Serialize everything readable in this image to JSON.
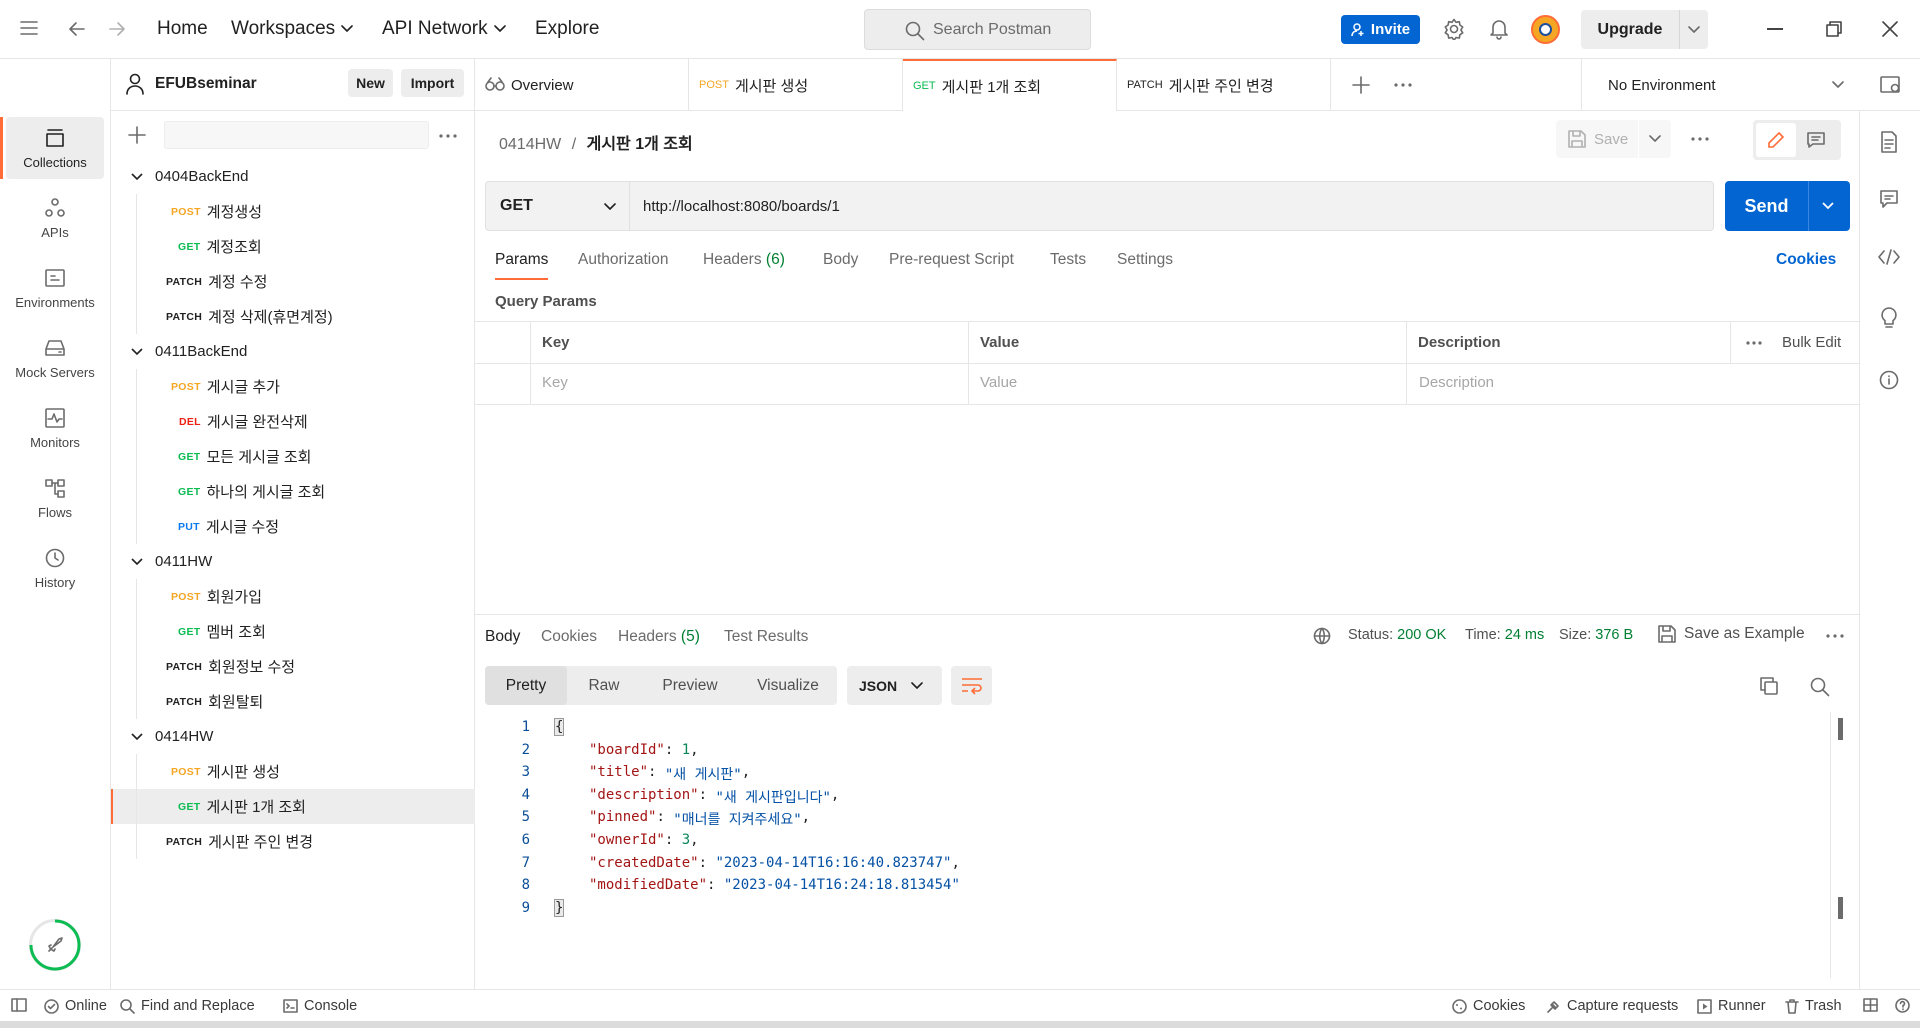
{
  "topbar": {
    "home": "Home",
    "workspaces": "Workspaces",
    "api_network": "API Network",
    "explore": "Explore",
    "search_placeholder": "Search Postman",
    "invite": "Invite",
    "upgrade": "Upgrade"
  },
  "rail": {
    "items": [
      {
        "label": "Collections",
        "icon": "collections-icon"
      },
      {
        "label": "APIs",
        "icon": "apis-icon"
      },
      {
        "label": "Environments",
        "icon": "environments-icon"
      },
      {
        "label": "Mock Servers",
        "icon": "mock-servers-icon"
      },
      {
        "label": "Monitors",
        "icon": "monitors-icon"
      },
      {
        "label": "Flows",
        "icon": "flows-icon"
      },
      {
        "label": "History",
        "icon": "history-icon"
      }
    ]
  },
  "workspace": {
    "name": "EFUBseminar",
    "new_label": "New",
    "import_label": "Import"
  },
  "tree": [
    {
      "type": "folder",
      "label": "0404BackEnd"
    },
    {
      "type": "request",
      "method": "POST",
      "label": "계정생성"
    },
    {
      "type": "request",
      "method": "GET",
      "label": "계정조회"
    },
    {
      "type": "request",
      "method": "PATCH",
      "label": "계정 수정"
    },
    {
      "type": "request",
      "method": "PATCH",
      "label": "계정 삭제(휴면계정)"
    },
    {
      "type": "folder",
      "label": "0411BackEnd"
    },
    {
      "type": "request",
      "method": "POST",
      "label": "게시글 추가"
    },
    {
      "type": "request",
      "method": "DEL",
      "label": "게시글 완전삭제"
    },
    {
      "type": "request",
      "method": "GET",
      "label": "모든 게시글 조회"
    },
    {
      "type": "request",
      "method": "GET",
      "label": "하나의 게시글 조회"
    },
    {
      "type": "request",
      "method": "PUT",
      "label": "게시글 수정"
    },
    {
      "type": "folder",
      "label": "0411HW"
    },
    {
      "type": "request",
      "method": "POST",
      "label": "회원가입"
    },
    {
      "type": "request",
      "method": "GET",
      "label": "멤버 조회"
    },
    {
      "type": "request",
      "method": "PATCH",
      "label": "회원정보 수정"
    },
    {
      "type": "request",
      "method": "PATCH",
      "label": "회원탈퇴"
    },
    {
      "type": "folder",
      "label": "0414HW"
    },
    {
      "type": "request",
      "method": "POST",
      "label": "게시판 생성"
    },
    {
      "type": "request",
      "method": "GET",
      "label": "게시판 1개 조회",
      "selected": true
    },
    {
      "type": "request",
      "method": "PATCH",
      "label": "게시판 주인 변경"
    }
  ],
  "tabs": [
    {
      "method": "",
      "label": "Overview"
    },
    {
      "method": "POST",
      "label": "게시판 생성"
    },
    {
      "method": "GET",
      "label": "게시판 1개 조회",
      "active": true
    },
    {
      "method": "PATCH",
      "label": "게시판 주인 변경"
    }
  ],
  "environment": "No Environment",
  "request": {
    "breadcrumb_parent": "0414HW",
    "breadcrumb_sep": "/",
    "breadcrumb_title": "게시판 1개 조회",
    "save_label": "Save",
    "method": "GET",
    "url": "http://localhost:8080/boards/1",
    "send_label": "Send",
    "subtabs": {
      "params": "Params",
      "authorization": "Authorization",
      "headers": "Headers",
      "headers_count": "(6)",
      "body": "Body",
      "prerequest": "Pre-request Script",
      "tests": "Tests",
      "settings": "Settings",
      "cookies": "Cookies"
    },
    "query_params_title": "Query Params",
    "table": {
      "key": "Key",
      "value": "Value",
      "description": "Description",
      "bulk_edit": "Bulk Edit",
      "key_placeholder": "Key",
      "value_placeholder": "Value",
      "description_placeholder": "Description"
    }
  },
  "response": {
    "tabs": {
      "body": "Body",
      "cookies": "Cookies",
      "headers": "Headers",
      "headers_count": "(5)",
      "test_results": "Test Results"
    },
    "status_label": "Status:",
    "status_value": "200 OK",
    "time_label": "Time:",
    "time_value": "24 ms",
    "size_label": "Size:",
    "size_value": "376 B",
    "save_example": "Save as Example",
    "views": {
      "pretty": "Pretty",
      "raw": "Raw",
      "preview": "Preview",
      "visualize": "Visualize"
    },
    "format": "JSON",
    "lines": [
      {
        "n": "1",
        "k": "",
        "v": "",
        "open": "{"
      },
      {
        "n": "2",
        "k": "\"boardId\"",
        "v": "1",
        "vt": "n",
        "comma": ","
      },
      {
        "n": "3",
        "k": "\"title\"",
        "v": "\"새 게시판\"",
        "vt": "s",
        "comma": ","
      },
      {
        "n": "4",
        "k": "\"description\"",
        "v": "\"새 게시판입니다\"",
        "vt": "s",
        "comma": ","
      },
      {
        "n": "5",
        "k": "\"pinned\"",
        "v": "\"매너를 지켜주세요\"",
        "vt": "s",
        "comma": ","
      },
      {
        "n": "6",
        "k": "\"ownerId\"",
        "v": "3",
        "vt": "n",
        "comma": ","
      },
      {
        "n": "7",
        "k": "\"createdDate\"",
        "v": "\"2023-04-14T16:16:40.823747\"",
        "vt": "s",
        "comma": ","
      },
      {
        "n": "8",
        "k": "\"modifiedDate\"",
        "v": "\"2023-04-14T16:24:18.813454\"",
        "vt": "s",
        "comma": ""
      },
      {
        "n": "9",
        "k": "",
        "v": "",
        "open": "}"
      }
    ]
  },
  "statusbar": {
    "online": "Online",
    "find_replace": "Find and Replace",
    "console": "Console",
    "cookies": "Cookies",
    "capture": "Capture requests",
    "runner": "Runner",
    "trash": "Trash"
  },
  "colors": {
    "accent": "#ff6c37",
    "primary": "#0265d2",
    "status_ok": "#007f31"
  }
}
